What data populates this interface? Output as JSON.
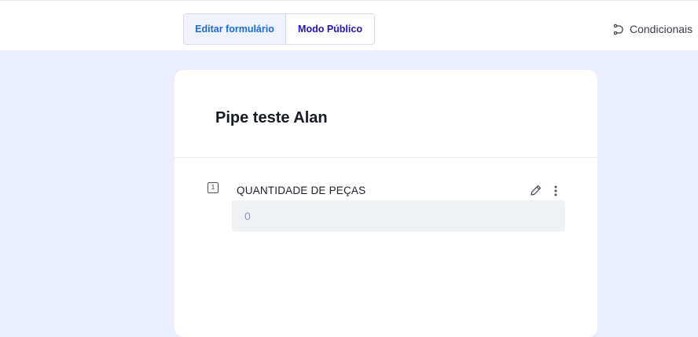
{
  "header": {
    "tabs": {
      "edit_form": "Editar formulário",
      "public_mode": "Modo Público"
    },
    "conditionals_label": "Condicionais",
    "conditionals_icon": "conditionals-icon"
  },
  "form": {
    "title": "Pipe teste Alan",
    "fields": [
      {
        "number": "1",
        "label": "QUANTIDADE DE PEÇAS",
        "value": "",
        "placeholder": "0",
        "edit_icon": "pencil-icon",
        "more_icon": "more-vertical-icon"
      }
    ]
  },
  "colors": {
    "background": "#e9effd",
    "active_tab_text": "#1e6ad1",
    "public_tab_text": "#2315a6",
    "input_bg": "#eef1f5"
  }
}
